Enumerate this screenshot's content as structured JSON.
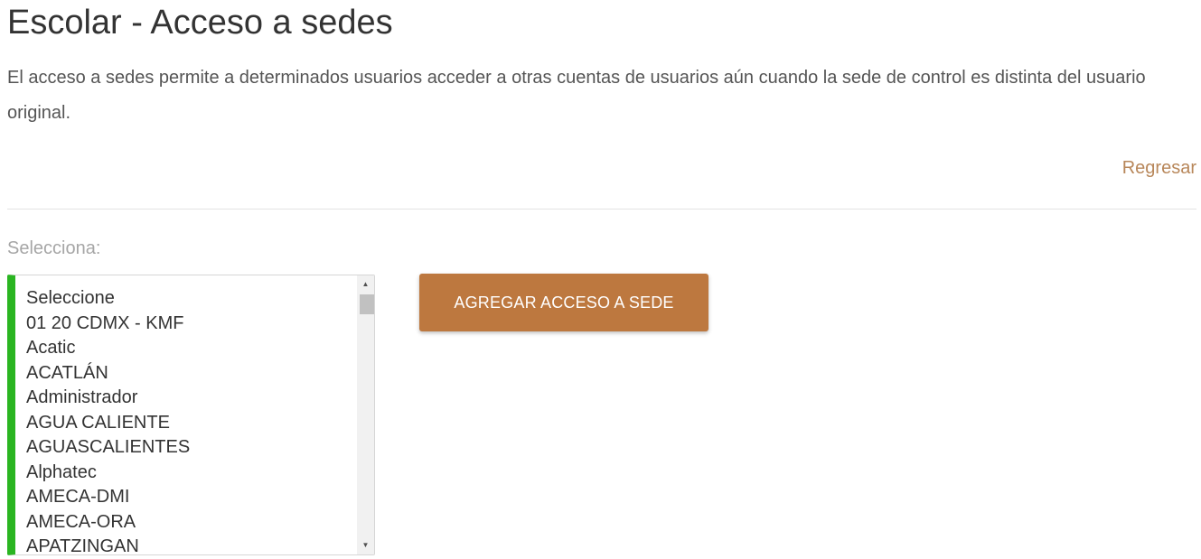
{
  "header": {
    "title": "Escolar - Acceso a sedes",
    "description": "El acceso a sedes permite a determinados usuarios acceder a otras cuentas de usuarios aún cuando la sede de control es distinta del usuario original.",
    "back_link": "Regresar"
  },
  "form": {
    "select_label": "Selecciona:",
    "options": [
      "Seleccione",
      "01 20 CDMX - KMF",
      "Acatic",
      "ACATLÁN",
      "Administrador",
      "AGUA CALIENTE",
      "AGUASCALIENTES",
      "Alphatec",
      "AMECA-DMI",
      "AMECA-ORA",
      "APATZINGAN"
    ],
    "submit_label": "AGREGAR ACCESO A SEDE"
  },
  "colors": {
    "accent_button": "#bd783f",
    "link": "#b8875a",
    "listbox_valid_border": "#2ab521"
  },
  "icons": {
    "scroll_up": "scroll-up-arrow-icon",
    "scroll_down": "scroll-down-arrow-icon"
  }
}
